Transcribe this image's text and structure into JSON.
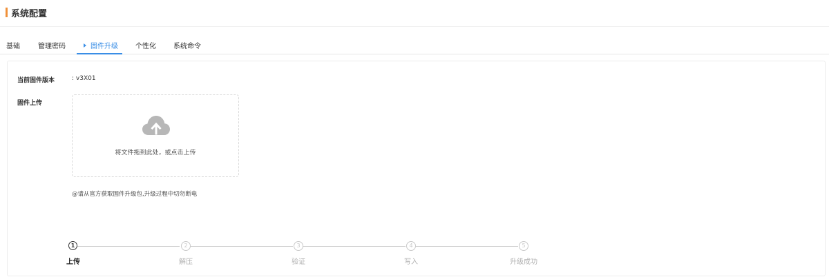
{
  "page": {
    "title": "系统配置",
    "accent_color": "#f0913a",
    "active_color": "#3a8ee6"
  },
  "tabs": [
    {
      "label": "基础",
      "active": false
    },
    {
      "label": "管理密码",
      "active": false
    },
    {
      "label": "固件升级",
      "active": true
    },
    {
      "label": "个性化",
      "active": false
    },
    {
      "label": "系统命令",
      "active": false
    }
  ],
  "firmware": {
    "current_version_label": "当前固件版本",
    "current_version_value": ": v3X01",
    "upload_label": "固件上传",
    "upload_icon": "cloud-upload-icon",
    "upload_hint": "将文件拖到此处，或点击上传",
    "note": "@请从官方获取固件升级包,升级过程中切勿断电"
  },
  "steps": [
    {
      "number": "1",
      "label": "上传",
      "active": true
    },
    {
      "number": "2",
      "label": "解压",
      "active": false
    },
    {
      "number": "3",
      "label": "验证",
      "active": false
    },
    {
      "number": "4",
      "label": "写入",
      "active": false
    },
    {
      "number": "5",
      "label": "升级成功",
      "active": false
    }
  ]
}
